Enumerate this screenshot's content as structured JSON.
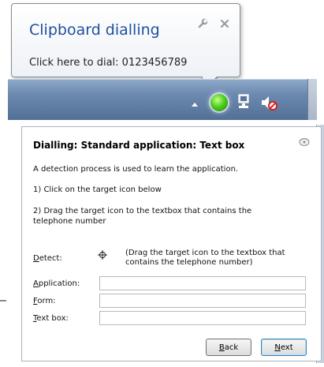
{
  "balloon": {
    "title": "Clipboard dialling",
    "message": "Click here to dial: 0123456789",
    "icons": [
      "wrench-icon",
      "close-icon"
    ]
  },
  "taskbar": {
    "icons": [
      "show-hidden-icons-arrow",
      "dialler-status-icon",
      "network-icon",
      "volume-muted-icon"
    ],
    "dialler_color": "#4fcf1f"
  },
  "dialog": {
    "title": "Dialling: Standard application: Text box",
    "intro": "A detection process is used to learn the application.",
    "step1": "1) Click on the target icon below",
    "step2": "2) Drag the target icon to the textbox that contains the telephone number",
    "detect": {
      "label_pre": "",
      "label_key": "D",
      "label_post": "etect:",
      "hint": "(Drag the target icon to the textbox that contains the telephone number)"
    },
    "fields": {
      "application": {
        "label_pre": "",
        "label_key": "A",
        "label_post": "pplication:",
        "value": ""
      },
      "form": {
        "label_pre": "",
        "label_key": "F",
        "label_post": "orm:",
        "value": ""
      },
      "textbox": {
        "label_pre": "",
        "label_key": "T",
        "label_post": "ext box:",
        "value": ""
      }
    },
    "buttons": {
      "back": {
        "pre": "",
        "key": "B",
        "post": "ack"
      },
      "next": {
        "pre": "",
        "key": "N",
        "post": "ext"
      }
    }
  }
}
